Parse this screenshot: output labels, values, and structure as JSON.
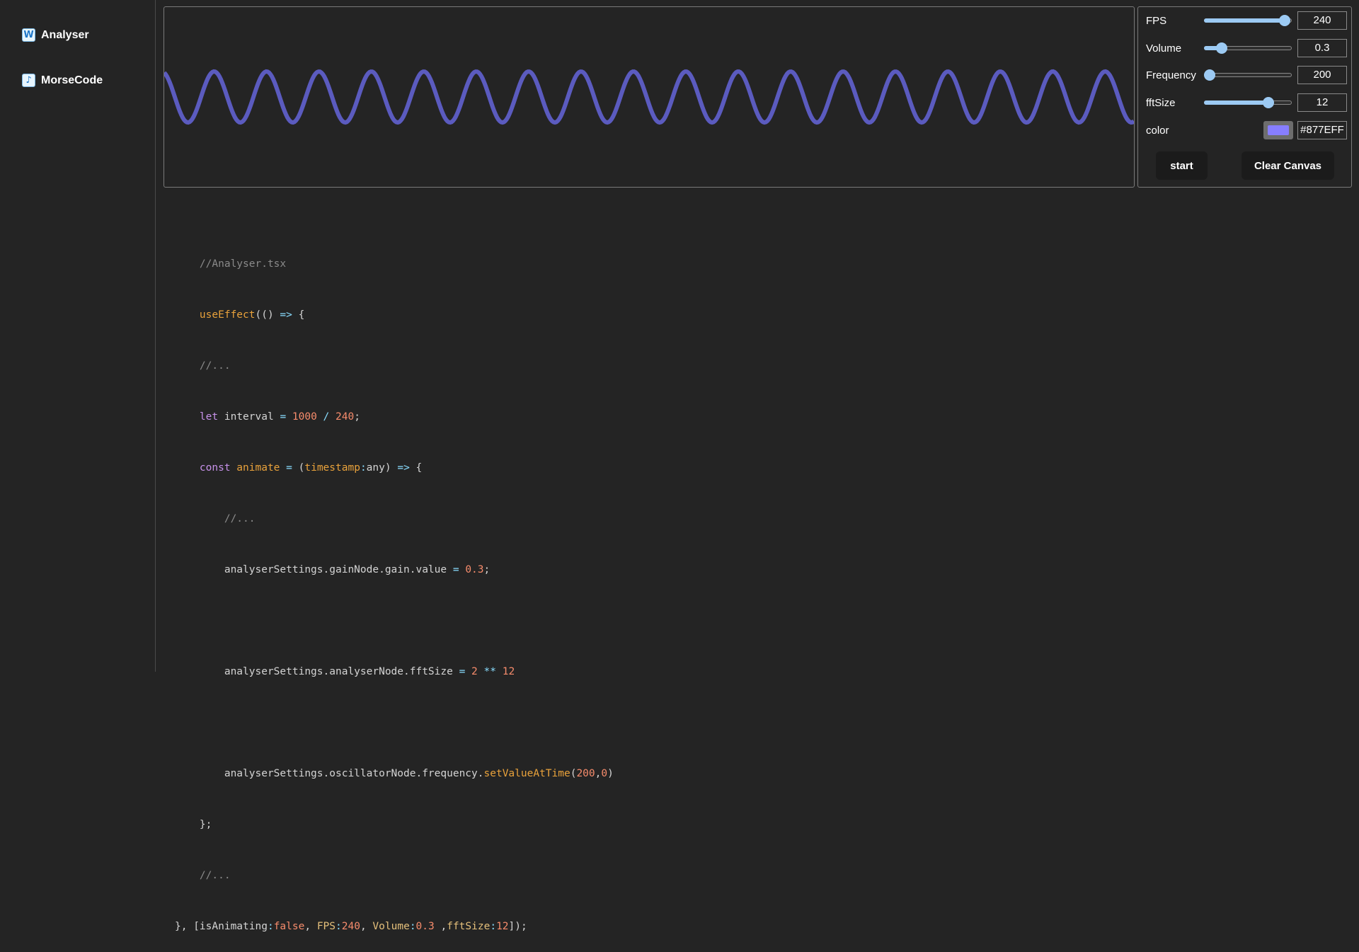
{
  "sidebar": {
    "items": [
      {
        "label": "Analyser",
        "icon": "W"
      },
      {
        "label": "MorseCode",
        "icon": "♪"
      }
    ]
  },
  "controls": {
    "fps": {
      "label": "FPS",
      "value": "240",
      "fraction": 0.98
    },
    "volume": {
      "label": "Volume",
      "value": "0.3",
      "fraction": 0.16
    },
    "frequency": {
      "label": "Frequency",
      "value": "200",
      "fraction": 0.0
    },
    "fftsize": {
      "label": "fftSize",
      "value": "12",
      "fraction": 0.77
    },
    "color": {
      "label": "color",
      "value": "#877EFF",
      "swatch": "#877EFF"
    },
    "start_label": "start",
    "clear_label": "Clear Canvas"
  },
  "waveform": {
    "color": "#5b5bbf",
    "cycles": 18.5
  },
  "code": {
    "l1": "//Analyser.tsx",
    "l2_fn": "useEffect",
    "l2_rest": "(() => {",
    "l3": "//...",
    "l4_kw": "let",
    "l4_var": " interval ",
    "l4_eq": "=",
    "l4_n1": " 1000",
    "l4_div": " /",
    "l4_n2": " 240",
    "l4_end": ";",
    "l5_kw": "const",
    "l5_name": " animate",
    "l5_eq": " =",
    "l5_open": " (",
    "l5_param": "timestamp",
    "l5_colon": ":",
    "l5_type": "any",
    "l5_close": ")",
    "l5_arrow": " =>",
    "l5_brace": " {",
    "l6": "//...",
    "l7_a": "analyserSettings.gainNode.gain.value",
    "l7_eq": " =",
    "l7_n": " 0.3",
    "l7_end": ";",
    "l9_a": "analyserSettings.analyserNode.fftSize",
    "l9_eq": " =",
    "l9_n1": " 2",
    "l9_op": " **",
    "l9_n2": " 12",
    "l11_a": "analyserSettings.oscillatorNode.frequency.",
    "l11_fn": "setValueAtTime",
    "l11_open": "(",
    "l11_n1": "200",
    "l11_comma": ",",
    "l11_n2": "0",
    "l11_close": ")",
    "l12": "};",
    "l13": "//...",
    "l14_a": "}, [isAnimating",
    "l14_c1": ":",
    "l14_v1": "false",
    "l14_s1": ", ",
    "l14_k2": "FPS",
    "l14_c2": ":",
    "l14_v2": "240",
    "l14_s2": ", ",
    "l14_k3": "Volume",
    "l14_c3": ":",
    "l14_v3": "0.3",
    "l14_s3": " ,",
    "l14_k4": "fftSize",
    "l14_c4": ":",
    "l14_v4": "12",
    "l14_end": "]);"
  }
}
